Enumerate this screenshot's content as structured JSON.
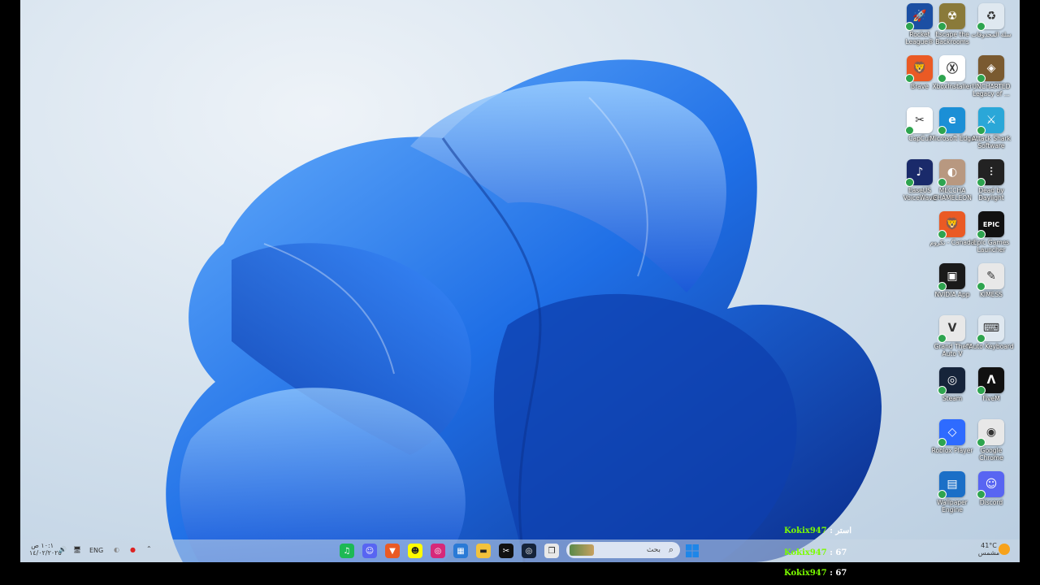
{
  "desktop_icons": [
    {
      "id": "rocket",
      "label": "Rocket League®",
      "color": "#1b4fa3",
      "glyph": "🚀"
    },
    {
      "id": "escape",
      "label": "Escape the Backrooms",
      "color": "#8a7a3a",
      "glyph": "☢"
    },
    {
      "id": "recycle",
      "label": "سلة المحذوفات",
      "color": "#dfe8f0",
      "glyph": "♻"
    },
    {
      "id": "brave",
      "label": "Brave",
      "color": "#ea5a24",
      "glyph": "🦁"
    },
    {
      "id": "xbox",
      "label": "XboxInstaller",
      "color": "#ffffff",
      "glyph": "Ⓧ"
    },
    {
      "id": "uncharted",
      "label": "UNCHARTED Legacy of ...",
      "color": "#7a5a30",
      "glyph": "◈"
    },
    {
      "id": "capcut",
      "label": "CapCut",
      "color": "#ffffff",
      "glyph": "✂"
    },
    {
      "id": "edge",
      "label": "Microsoft Edge",
      "color": "#1b8fd6",
      "glyph": "e"
    },
    {
      "id": "attack",
      "label": "Attack Shark Software",
      "color": "#2aa7d8",
      "glyph": "⚔"
    },
    {
      "id": "voicewave",
      "label": "EaseUS VoiceWave",
      "color": "#1a2a6a",
      "glyph": "♪"
    },
    {
      "id": "chameleon",
      "label": "MECCHA CHAMELEON",
      "color": "#b89880",
      "glyph": "◐"
    },
    {
      "id": "dbd",
      "label": "Dead by Daylight",
      "color": "#222222",
      "glyph": "⫶"
    },
    {
      "id": "brave2",
      "label": "نكروم - Canada",
      "color": "#ea5a24",
      "glyph": "🦁"
    },
    {
      "id": "epic",
      "label": "Epic Games Launcher",
      "color": "#111111",
      "glyph": "EPIC"
    },
    {
      "id": "nvidia",
      "label": "NVIDIA App",
      "color": "#1a1a1a",
      "glyph": "▣"
    },
    {
      "id": "kimess",
      "label": "KIMESS",
      "color": "#e8e8e8",
      "glyph": "✎"
    },
    {
      "id": "gta",
      "label": "Grand Theft Auto V",
      "color": "#e8e8e8",
      "glyph": "V"
    },
    {
      "id": "autokb",
      "label": "Auto Keyboard",
      "color": "#dfe8f0",
      "glyph": "⌨"
    },
    {
      "id": "steam",
      "label": "Steam",
      "color": "#16243a",
      "glyph": "◎"
    },
    {
      "id": "fivem",
      "label": "FiveM",
      "color": "#111111",
      "glyph": "Λ"
    },
    {
      "id": "roblox",
      "label": "Roblox Player",
      "color": "#2e6bff",
      "glyph": "◇"
    },
    {
      "id": "chrome",
      "label": "Google Chrome",
      "color": "#e8e8e8",
      "glyph": "◉"
    },
    {
      "id": "wallpaper",
      "label": "Wallpaper Engine",
      "color": "#1b6fc7",
      "glyph": "▤"
    },
    {
      "id": "discord",
      "label": "Discord",
      "color": "#5865f2",
      "glyph": "☺"
    }
  ],
  "taskbar": {
    "search_placeholder": "بحث",
    "apps": [
      {
        "id": "spotify",
        "color": "#1db954",
        "glyph": "♫"
      },
      {
        "id": "discord",
        "color": "#5865f2",
        "glyph": "☺"
      },
      {
        "id": "brave",
        "color": "#ea5a24",
        "glyph": "▼"
      },
      {
        "id": "snapchat",
        "color": "#fffc00",
        "glyph": "☻"
      },
      {
        "id": "instagram",
        "color": "#d6297a",
        "glyph": "◎"
      },
      {
        "id": "store",
        "color": "#2a7ad6",
        "glyph": "▦"
      },
      {
        "id": "explorer",
        "color": "#f3c23c",
        "glyph": "▬"
      },
      {
        "id": "capcut",
        "color": "#111111",
        "glyph": "✂"
      },
      {
        "id": "steam",
        "color": "#16243a",
        "glyph": "◎"
      },
      {
        "id": "taskview",
        "color": "#e8e8e8",
        "glyph": "❐"
      }
    ],
    "tray": {
      "clock_time": "١٠:١ ص",
      "clock_date": "١٤/٠٢/٢٠٢٥",
      "language": "ENG",
      "weather_temp": "41°C",
      "weather_text": "مشمس"
    }
  },
  "overlay": {
    "line1_name": "Kokix947",
    "line1_sep": " : ",
    "line1_value": "استر",
    "line2_name": "Kokix947",
    "line2_sep": " : ",
    "line2_value": "67",
    "line3_name": "Kokix947",
    "line3_sep": " : ",
    "line3_value": "67",
    "name_color": "#7CFC00"
  }
}
